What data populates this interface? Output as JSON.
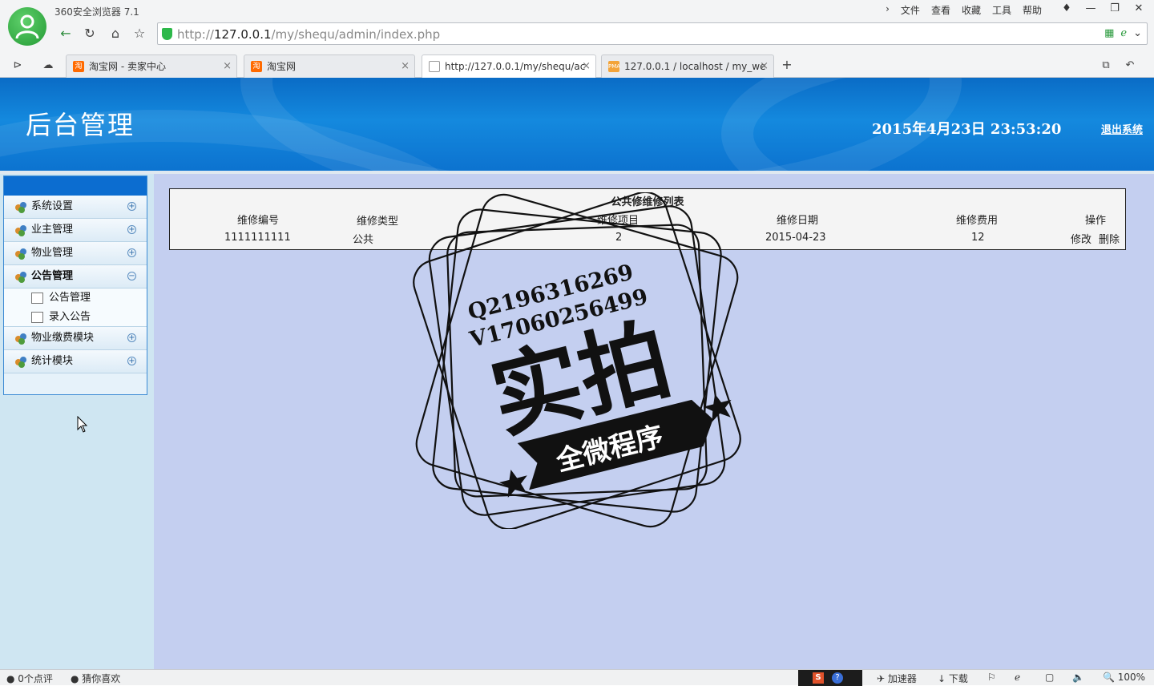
{
  "browser": {
    "app_title": "360安全浏览器 7.1",
    "menu": [
      "文件",
      "查看",
      "收藏",
      "工具",
      "帮助"
    ],
    "address": {
      "prefix": "http://",
      "host": "127.0.0.1",
      "path": "/my/shequ/admin/index.php"
    },
    "tabs": [
      {
        "label": "淘宝网 - 卖家中心",
        "icon": "taobao-icon"
      },
      {
        "label": "淘宝网",
        "icon": "taobao-icon"
      },
      {
        "label": "http://127.0.0.1/my/shequ/ac",
        "icon": "page-icon",
        "active": true
      },
      {
        "label": "127.0.0.1 / localhost / my_we",
        "icon": "phpmyadmin-icon"
      }
    ],
    "tab_icon_text": {
      "taobao": "淘",
      "pma": "PMA"
    }
  },
  "header": {
    "title": "后台管理",
    "datetime": "2015年4月23日  23:53:20",
    "logout": "退出系统"
  },
  "sidebar": {
    "groups": [
      {
        "label": "系统设置",
        "expanded": false
      },
      {
        "label": "业主管理",
        "expanded": false
      },
      {
        "label": "物业管理",
        "expanded": false
      },
      {
        "label": "公告管理",
        "expanded": true,
        "children": [
          "公告管理",
          "录入公告"
        ]
      },
      {
        "label": "物业缴费模块",
        "expanded": false
      },
      {
        "label": "统计模块",
        "expanded": false
      }
    ],
    "plus": "+",
    "minus": "−"
  },
  "list": {
    "title": "公共修维修列表",
    "columns": [
      "维修编号",
      "维修类型",
      "维修项目",
      "维修日期",
      "维修费用",
      "操作"
    ],
    "rows": [
      {
        "id": "1111111111",
        "type": "公共",
        "item": "2",
        "date": "2015-04-23",
        "cost": "12",
        "edit": "修改",
        "delete": "删除"
      }
    ]
  },
  "watermark": {
    "line1": "Q2196316269",
    "line2": "V17060256499",
    "big": "实拍",
    "ribbon": "全微程序"
  },
  "statusbar": {
    "comments": "0个点评",
    "guess": "猜你喜欢",
    "accelerator": "加速器",
    "download": "下载",
    "zoom": "100%"
  },
  "colors": {
    "banner": "#1489de",
    "sidebar_head": "#0c6dd0",
    "main_bg": "#c4cff0",
    "sidebar_bg": "#cfe6f2"
  }
}
